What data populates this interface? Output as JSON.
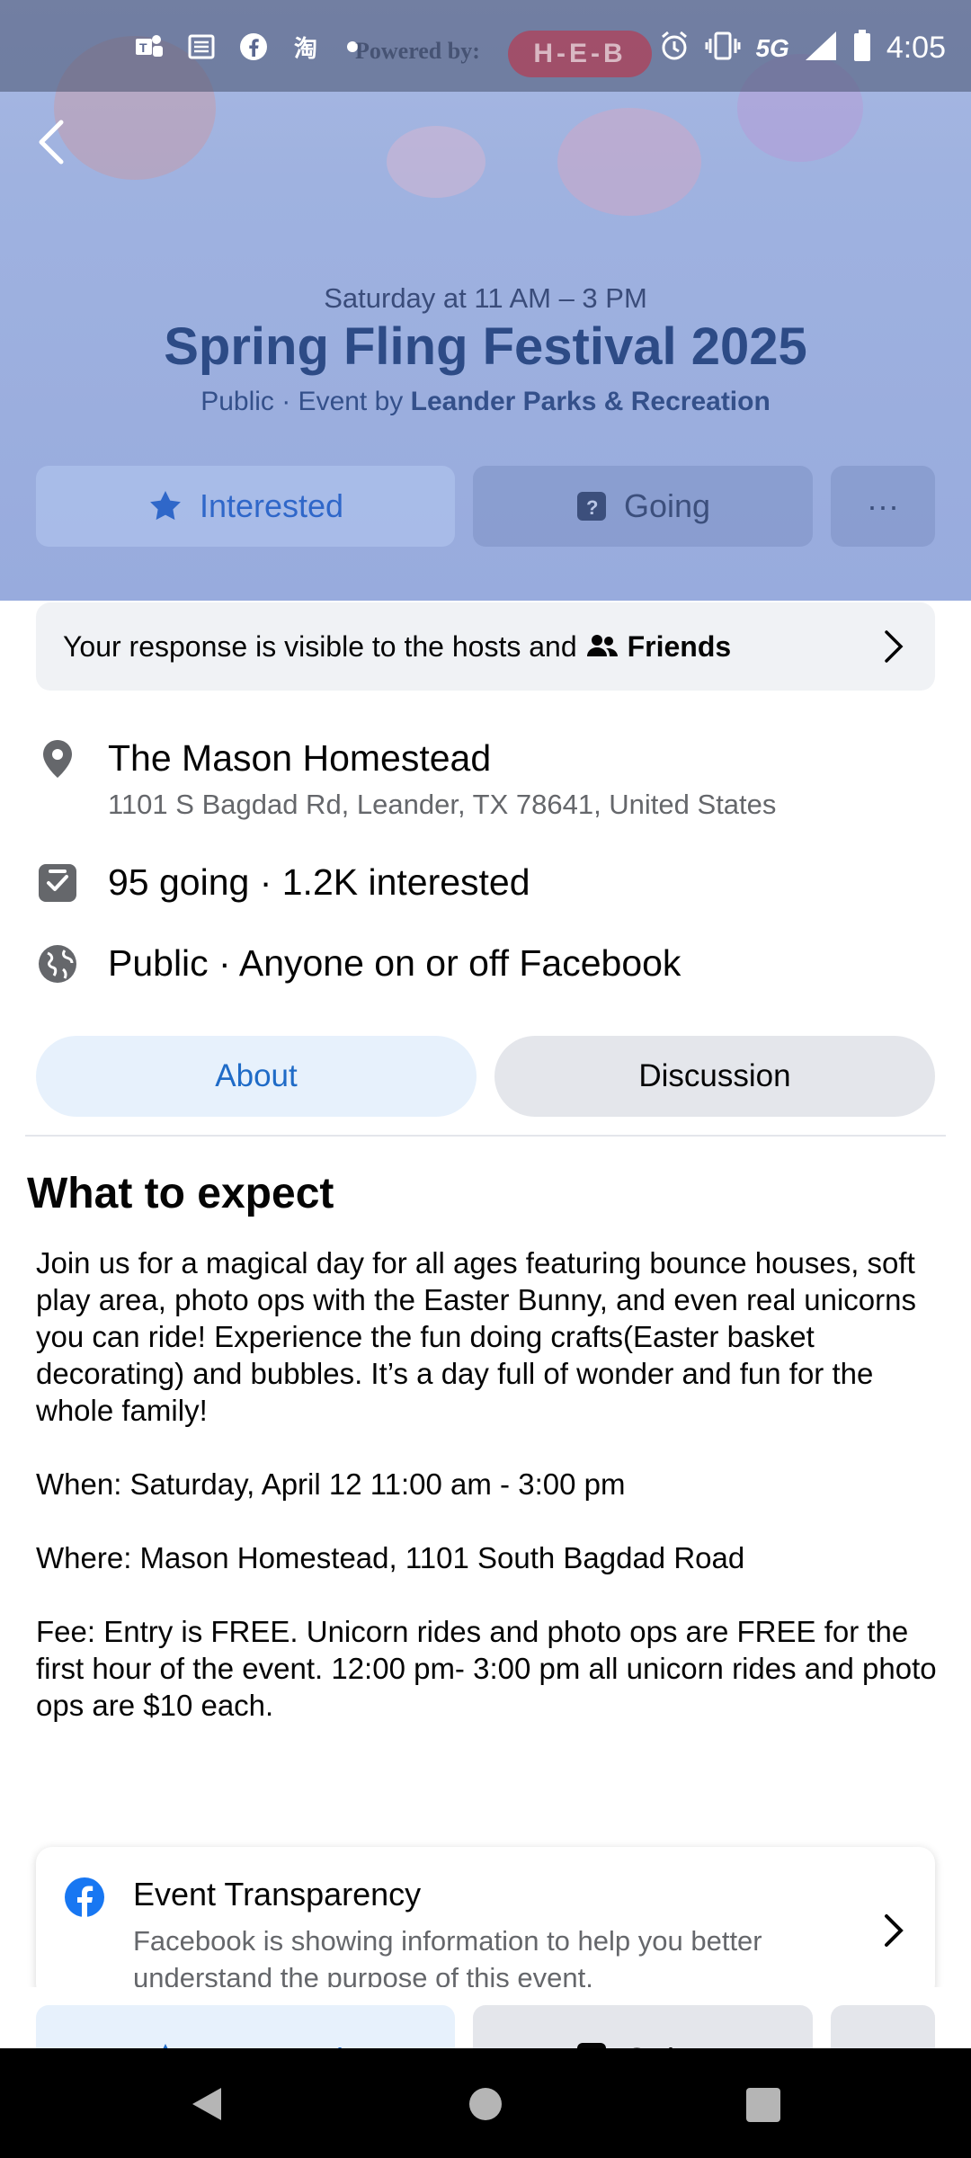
{
  "status_bar": {
    "time": "4:05",
    "network": "5G",
    "ad_text": "Powered by:",
    "ad_brand": "H-E-B"
  },
  "event": {
    "date_time": "Saturday at 11 AM – 3 PM",
    "title": "Spring Fling Festival 2025",
    "host_prefix": "Public · Event by ",
    "host_name": "Leander Parks & Recreation"
  },
  "actions": {
    "interested": "Interested",
    "going": "Going",
    "more": "···"
  },
  "visibility": {
    "text": "Your response is visible to the hosts and",
    "audience": "Friends"
  },
  "details": {
    "location_name": "The Mason Homestead",
    "location_address": "1101 S Bagdad Rd, Leander, TX 78641, United States",
    "attendance": "95 going · 1.2K interested",
    "privacy": "Public · Anyone on or off Facebook"
  },
  "tabs": [
    {
      "label": "About",
      "active": true
    },
    {
      "label": "Discussion",
      "active": false
    }
  ],
  "about": {
    "section_title": "What to expect",
    "paragraphs": [
      "Join us for a magical day for all ages featuring bounce houses, soft play area, photo ops with the Easter Bunny, and even real unicorns you can ride! Experience the fun doing crafts(Easter basket decorating) and bubbles. It’s a day full of wonder and fun for the whole family!",
      "When: Saturday, April 12 11:00 am - 3:00 pm",
      "Where: Mason Homestead, 1101 South Bagdad Road",
      "Fee: Entry is FREE. Unicorn rides and photo ops are FREE for the first hour of the event. 12:00 pm- 3:00 pm all unicorn rides and photo ops are $10 each."
    ]
  },
  "transparency": {
    "title": "Event Transparency",
    "subtitle": "Facebook is showing information to help you better understand the purpose of this event."
  },
  "colors": {
    "accent": "#1f6bc7",
    "cover_tint": "#9fb2e0",
    "facebook_blue": "#1877f2"
  }
}
